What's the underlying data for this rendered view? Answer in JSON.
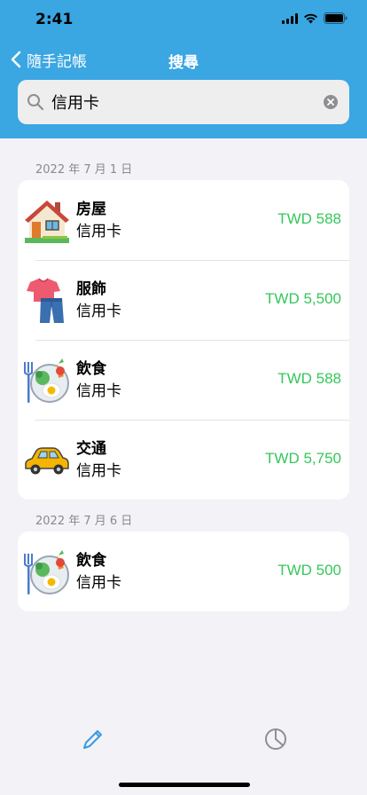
{
  "status_bar": {
    "time": "2:41"
  },
  "nav": {
    "back_label": "隨手記帳",
    "title": "搜尋"
  },
  "search": {
    "value": "信用卡"
  },
  "groups": [
    {
      "date": "2022 年 7 月 1 日",
      "items": [
        {
          "category": "房屋",
          "payment": "信用卡",
          "amount": "TWD 588",
          "icon": "house-icon"
        },
        {
          "category": "服飾",
          "payment": "信用卡",
          "amount": "TWD 5,500",
          "icon": "clothing-icon"
        },
        {
          "category": "飲食",
          "payment": "信用卡",
          "amount": "TWD 588",
          "icon": "food-icon"
        },
        {
          "category": "交通",
          "payment": "信用卡",
          "amount": "TWD 5,750",
          "icon": "car-icon"
        }
      ]
    },
    {
      "date": "2022 年 7 月 6 日",
      "items": [
        {
          "category": "飲食",
          "payment": "信用卡",
          "amount": "TWD 500",
          "icon": "food-icon"
        }
      ]
    }
  ],
  "tab_bar": {
    "items": [
      "pencil-icon",
      "pie-chart-icon"
    ]
  },
  "colors": {
    "header": "#3aa6e2",
    "amount": "#34c759",
    "background": "#f2f2f7"
  }
}
